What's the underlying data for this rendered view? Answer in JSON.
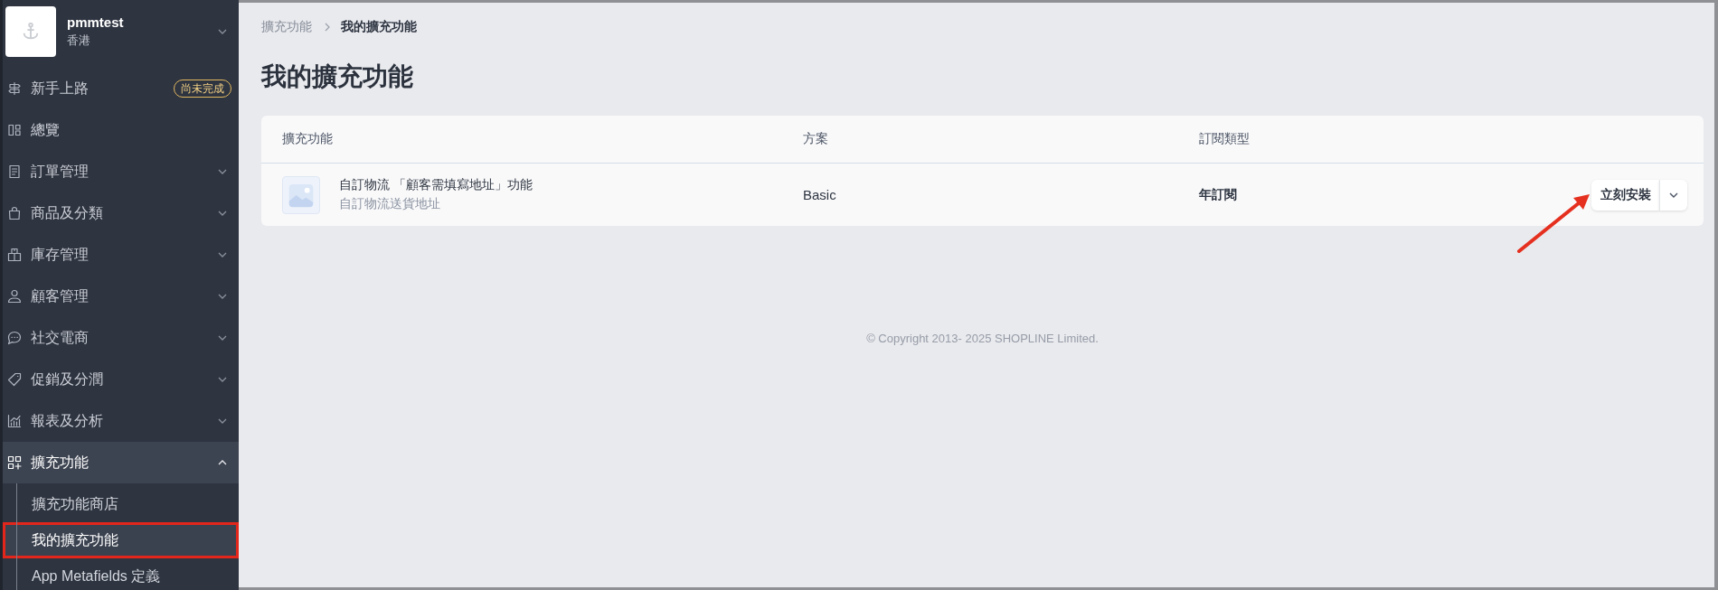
{
  "sidebar": {
    "store": {
      "name": "pmmtest",
      "region": "香港"
    },
    "items": [
      {
        "label": "新手上路",
        "badge": "尚未完成",
        "expandable": false,
        "expanded": false
      },
      {
        "label": "總覽",
        "expandable": false,
        "expanded": false
      },
      {
        "label": "訂單管理",
        "expandable": true,
        "expanded": false
      },
      {
        "label": "商品及分類",
        "expandable": true,
        "expanded": false
      },
      {
        "label": "庫存管理",
        "expandable": true,
        "expanded": false
      },
      {
        "label": "顧客管理",
        "expandable": true,
        "expanded": false
      },
      {
        "label": "社交電商",
        "expandable": true,
        "expanded": false
      },
      {
        "label": "促銷及分潤",
        "expandable": true,
        "expanded": false
      },
      {
        "label": "報表及分析",
        "expandable": true,
        "expanded": false
      },
      {
        "label": "擴充功能",
        "expandable": true,
        "expanded": true,
        "children": [
          {
            "label": "擴充功能商店",
            "selected": false,
            "outlined": false
          },
          {
            "label": "我的擴充功能",
            "selected": true,
            "outlined": true
          },
          {
            "label": "App Metafields 定義",
            "selected": false,
            "outlined": false
          }
        ]
      }
    ]
  },
  "breadcrumb": [
    {
      "label": "擴充功能",
      "current": false
    },
    {
      "label": "我的擴充功能",
      "current": true
    }
  ],
  "page_title": "我的擴充功能",
  "table": {
    "columns": [
      "擴充功能",
      "方案",
      "訂閱類型"
    ],
    "rows": [
      {
        "name": "自訂物流 「顧客需填寫地址」功能",
        "description": "自訂物流送貨地址",
        "plan": "Basic",
        "subscription": "年訂閱",
        "action": {
          "label": "立刻安裝",
          "pointed_at": true
        }
      }
    ]
  },
  "footer": "© Copyright 2013- 2025 SHOPLINE Limited."
}
